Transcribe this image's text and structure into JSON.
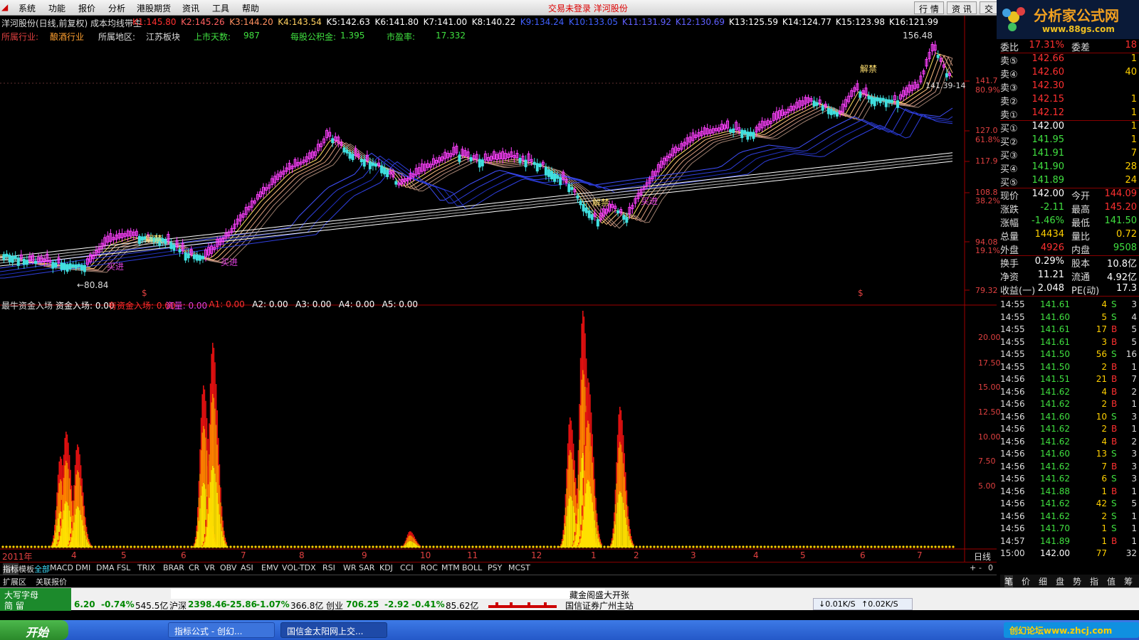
{
  "menu": {
    "items": [
      "系统",
      "功能",
      "报价",
      "分析",
      "港股期货",
      "资讯",
      "工具",
      "帮助"
    ],
    "center": "交易未登录 洋河股份",
    "tabs": [
      "行 情",
      "资 讯",
      "交"
    ]
  },
  "logo": {
    "text": "分析家公式网",
    "url": "www.88gs.com"
  },
  "header": {
    "title": "洋河股份(日线,前复权) 成本均线带主",
    "k": [
      {
        "label": "K1:",
        "value": "145.80"
      },
      {
        "label": "K2:",
        "value": "145.26"
      },
      {
        "label": "K3:",
        "value": "144.20"
      },
      {
        "label": "K4:",
        "value": "143.54"
      },
      {
        "label": "K5:",
        "value": "142.63"
      },
      {
        "label": "K6:",
        "value": "141.80"
      },
      {
        "label": "K7:",
        "value": "141.00"
      },
      {
        "label": "K8:",
        "value": "140.22"
      },
      {
        "label": "K9:",
        "value": "134.24"
      },
      {
        "label": "K10:",
        "value": "133.05"
      },
      {
        "label": "K11:",
        "value": "131.92"
      },
      {
        "label": "K12:",
        "value": "130.69"
      },
      {
        "label": "K13:",
        "value": "125.59"
      },
      {
        "label": "K14:",
        "value": "124.77"
      },
      {
        "label": "K15:",
        "value": "123.98"
      },
      {
        "label": "K16:",
        "value": "121.99"
      }
    ]
  },
  "info": {
    "industry_label": "所属行业:",
    "industry": "酿酒行业",
    "region_label": "所属地区:",
    "region": "江苏板块",
    "days_label": "上市天数:",
    "days": "987",
    "fund_label": "每股公积金:",
    "fund": "1.395",
    "pe_label": "市盈率:",
    "pe": "17.332"
  },
  "price_axis": {
    "ticks": [
      "141.7",
      "127.0",
      "117.9",
      "108.8",
      "94.08",
      "79.32"
    ],
    "pcts": [
      "80.9%",
      "61.8%",
      "38.2%",
      "19.1%"
    ],
    "high_label": "156.48",
    "low_label": "←80.84",
    "cursor_label": "141.39-14"
  },
  "annotations": {
    "jie1": "解禁",
    "jie2": "解禁",
    "jie3": "解禁",
    "buy1": "买进",
    "buy2": "买进",
    "buy3": "买进",
    "dollar": "$"
  },
  "indicator": {
    "name": "最牛资金入场",
    "items": [
      {
        "label": "资金入场:",
        "value": "0.00"
      },
      {
        "label": "有资金入场:",
        "value": "0.00"
      },
      {
        "label": "资量:",
        "value": "0.00"
      },
      {
        "label": "A1:",
        "value": "0.00"
      },
      {
        "label": "A2:",
        "value": "0.00"
      },
      {
        "label": "A3:",
        "value": "0.00"
      },
      {
        "label": "A4:",
        "value": "0.00"
      },
      {
        "label": "A5:",
        "value": "0.00"
      }
    ],
    "ticks": [
      "20.00",
      "17.50",
      "15.00",
      "12.50",
      "10.00",
      "7.50",
      "5.00"
    ]
  },
  "xaxis": {
    "year": "2011年",
    "months": [
      "4",
      "5",
      "6",
      "7",
      "8",
      "9",
      "10",
      "11",
      "12",
      "1",
      "2",
      "3",
      "4",
      "5",
      "6",
      "7"
    ],
    "period": "日线"
  },
  "bottom_tabs": [
    "指标",
    "模板",
    "全部",
    "MACD",
    "DMI",
    "DMA",
    "FSL",
    "TRIX",
    "BRAR",
    "CR",
    "VR",
    "OBV",
    "ASI",
    "EMV",
    "VOL-TDX",
    "RSI",
    "WR",
    "SAR",
    "KDJ",
    "CCI",
    "ROC",
    "MTM",
    "BOLL",
    "PSY",
    "MCST"
  ],
  "ext_tabs": [
    "扩展区",
    "关联报价"
  ],
  "zoom": [
    "+",
    "-",
    "0"
  ],
  "right_panel": {
    "weibi": {
      "label": "委比",
      "value": "17.31%",
      "diff_label": "委差",
      "diff": "18"
    },
    "sell": [
      {
        "label": "卖⑤",
        "price": "142.66",
        "vol": "1"
      },
      {
        "label": "卖④",
        "price": "142.60",
        "vol": "40"
      },
      {
        "label": "卖③",
        "price": "142.30",
        "vol": ""
      },
      {
        "label": "卖②",
        "price": "142.15",
        "vol": "1"
      },
      {
        "label": "卖①",
        "price": "142.12",
        "vol": "1"
      }
    ],
    "buy": [
      {
        "label": "买①",
        "price": "142.00",
        "vol": "1"
      },
      {
        "label": "买②",
        "price": "141.95",
        "vol": "1"
      },
      {
        "label": "买③",
        "price": "141.91",
        "vol": "7"
      },
      {
        "label": "买④",
        "price": "141.90",
        "vol": "28"
      },
      {
        "label": "买⑤",
        "price": "141.89",
        "vol": "24"
      }
    ],
    "quote": [
      {
        "l1": "现价",
        "v1": "142.00",
        "l2": "今开",
        "v2": "144.09"
      },
      {
        "l1": "涨跌",
        "v1": "-2.11",
        "l2": "最高",
        "v2": "145.20"
      },
      {
        "l1": "涨幅",
        "v1": "-1.46%",
        "l2": "最低",
        "v2": "141.50"
      },
      {
        "l1": "总量",
        "v1": "14434",
        "l2": "量比",
        "v2": "0.72"
      },
      {
        "l1": "外盘",
        "v1": "4926",
        "l2": "内盘",
        "v2": "9508"
      }
    ],
    "stats": [
      {
        "l1": "换手",
        "v1": "0.29%",
        "l2": "股本",
        "v2": "10.8亿"
      },
      {
        "l1": "净资",
        "v1": "11.21",
        "l2": "流通",
        "v2": "4.92亿"
      },
      {
        "l1": "收益(一)",
        "v1": "2.048",
        "l2": "PE(动)",
        "v2": "17.3"
      }
    ],
    "ticks": [
      [
        "14:55",
        "141.61",
        "4",
        "S",
        "3"
      ],
      [
        "14:55",
        "141.60",
        "5",
        "S",
        "4"
      ],
      [
        "14:55",
        "141.61",
        "17",
        "B",
        "5"
      ],
      [
        "14:55",
        "141.61",
        "3",
        "B",
        "5"
      ],
      [
        "14:55",
        "141.50",
        "56",
        "S",
        "16"
      ],
      [
        "14:55",
        "141.50",
        "2",
        "B",
        "1"
      ],
      [
        "14:56",
        "141.51",
        "21",
        "B",
        "7"
      ],
      [
        "14:56",
        "141.62",
        "4",
        "B",
        "2"
      ],
      [
        "14:56",
        "141.62",
        "2",
        "B",
        "1"
      ],
      [
        "14:56",
        "141.60",
        "10",
        "S",
        "3"
      ],
      [
        "14:56",
        "141.62",
        "2",
        "B",
        "1"
      ],
      [
        "14:56",
        "141.62",
        "4",
        "B",
        "2"
      ],
      [
        "14:56",
        "141.60",
        "13",
        "S",
        "3"
      ],
      [
        "14:56",
        "141.62",
        "7",
        "B",
        "3"
      ],
      [
        "14:56",
        "141.62",
        "6",
        "S",
        "3"
      ],
      [
        "14:56",
        "141.88",
        "1",
        "B",
        "1"
      ],
      [
        "14:56",
        "141.62",
        "42",
        "S",
        "5"
      ],
      [
        "14:56",
        "141.62",
        "2",
        "S",
        "1"
      ],
      [
        "14:56",
        "141.70",
        "1",
        "S",
        "1"
      ],
      [
        "14:57",
        "141.89",
        "1",
        "B",
        "1"
      ],
      [
        "15:00",
        "142.00",
        "77",
        "",
        "32"
      ]
    ],
    "bottom_tabs": [
      "笔",
      "价",
      "细",
      "盘",
      "势",
      "指",
      "值",
      "筹"
    ]
  },
  "status": {
    "ime": "大写字母",
    "ime2": "简 留",
    "index1_val": "6.20",
    "index1_chg": "-0.74%",
    "index1_amt": "545.5亿",
    "index2_name": "沪深",
    "index2_val": "2398.46",
    "index2_chg": "-25.86",
    "index2_pct": "-1.07%",
    "index2_amt": "366.8亿",
    "index3_name": "创业",
    "index3_val": "706.25",
    "index3_chg": "-2.92",
    "index3_pct": "-0.41%",
    "index3_amt": "85.62亿",
    "broker": "国信证券广州主站",
    "net_down": "↓0.01K/S",
    "net_up": "↑0.02K/S",
    "banner": "藏金阁盛大开张"
  },
  "taskbar": {
    "start": "开始",
    "task1": "指标公式 - 创幻...",
    "task2": "国信金太阳网上交...",
    "tray": "创幻论坛www.zhcj.com"
  }
}
